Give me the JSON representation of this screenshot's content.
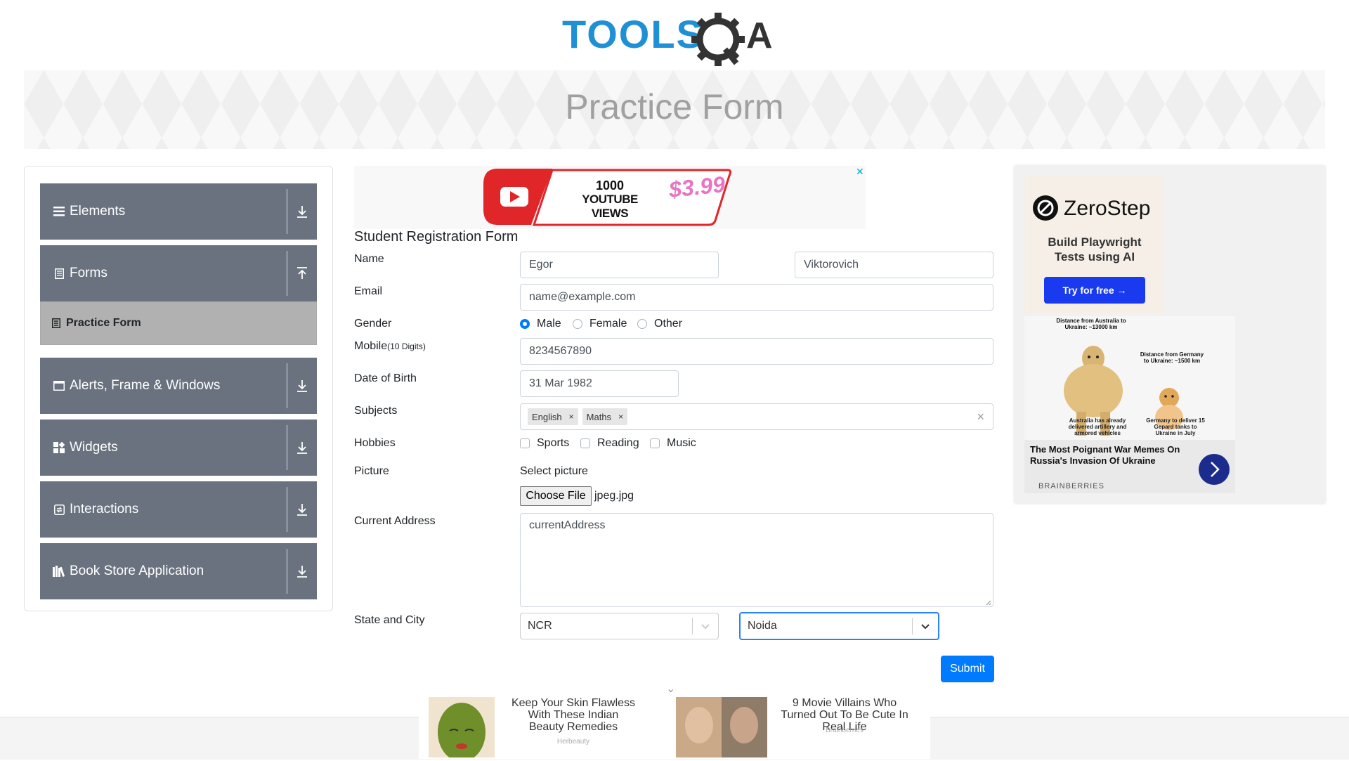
{
  "logo": {
    "text_main": "TOOLS",
    "text_q": "Q",
    "text_a": "A",
    "alt": "ToolsQA"
  },
  "banner": {
    "title": "Practice Form"
  },
  "sidebar": {
    "groups": [
      {
        "label": "Elements",
        "icon": "hamburger-icon",
        "arrow": "download-icon"
      },
      {
        "label": "Forms",
        "icon": "document-icon",
        "arrow": "upload-icon"
      },
      {
        "label": "Alerts, Frame & Windows",
        "icon": "window-icon",
        "arrow": "download-icon"
      },
      {
        "label": "Widgets",
        "icon": "widgets-icon",
        "arrow": "download-icon"
      },
      {
        "label": "Interactions",
        "icon": "interaction-icon",
        "arrow": "download-icon"
      },
      {
        "label": "Book Store Application",
        "icon": "books-icon",
        "arrow": "download-icon"
      }
    ],
    "active_item": {
      "label": "Practice Form",
      "icon": "form-icon"
    }
  },
  "ad_top": {
    "text_line1": "1000",
    "text_line2": "YOUTUBE VIEWS",
    "price": "$3.99",
    "close": "✕"
  },
  "form": {
    "heading": "Student Registration Form",
    "name": {
      "label": "Name",
      "first": "Egor",
      "last": "Viktorovich"
    },
    "email": {
      "label": "Email",
      "value": "name@example.com"
    },
    "gender": {
      "label": "Gender",
      "options": [
        "Male",
        "Female",
        "Other"
      ],
      "selected": "Male"
    },
    "mobile": {
      "label": "Mobile",
      "hint": "(10 Digits)",
      "value": "8234567890"
    },
    "dob": {
      "label": "Date of Birth",
      "value": "31 Mar 1982"
    },
    "subjects": {
      "label": "Subjects",
      "chips": [
        "English",
        "Maths"
      ],
      "chip_remove": "×",
      "clear": "×"
    },
    "hobbies": {
      "label": "Hobbies",
      "options": [
        "Sports",
        "Reading",
        "Music"
      ]
    },
    "picture": {
      "label": "Picture",
      "caption": "Select picture",
      "button": "Choose File",
      "file": "jpeg.jpg"
    },
    "address": {
      "label": "Current Address",
      "value": "currentAddress"
    },
    "state_city": {
      "label": "State and City",
      "state": "NCR",
      "city": "Noida"
    },
    "submit": "Submit"
  },
  "right_ad": {
    "brand": "ZeroStep",
    "tagline": "Build Playwright Tests using AI",
    "cta": "Try for free →",
    "meme_left_caption": "Distance from Australia to Ukraine: ~13000 km",
    "meme_right_caption": "Distance from Germany to Ukraine: ~1500 km",
    "meme_left_bottom": "Australia has already delivered artillery and armored vehicles",
    "meme_right_bottom": "Germany to deliver 15 Gepard tanks to Ukraine in July",
    "headline": "The Most Poignant War Memes On Russia's Invasion Of Ukraine",
    "source": "BRAINBERRIES"
  },
  "bottom_ad": {
    "chevron": "⌄",
    "item1": {
      "title": "Keep Your Skin Flawless With These Indian Beauty Remedies",
      "source": "Herbeauty"
    },
    "item2": {
      "title": "9 Movie Villains Who Turned Out To Be Cute In Real Life",
      "source": "Brainberries"
    }
  }
}
